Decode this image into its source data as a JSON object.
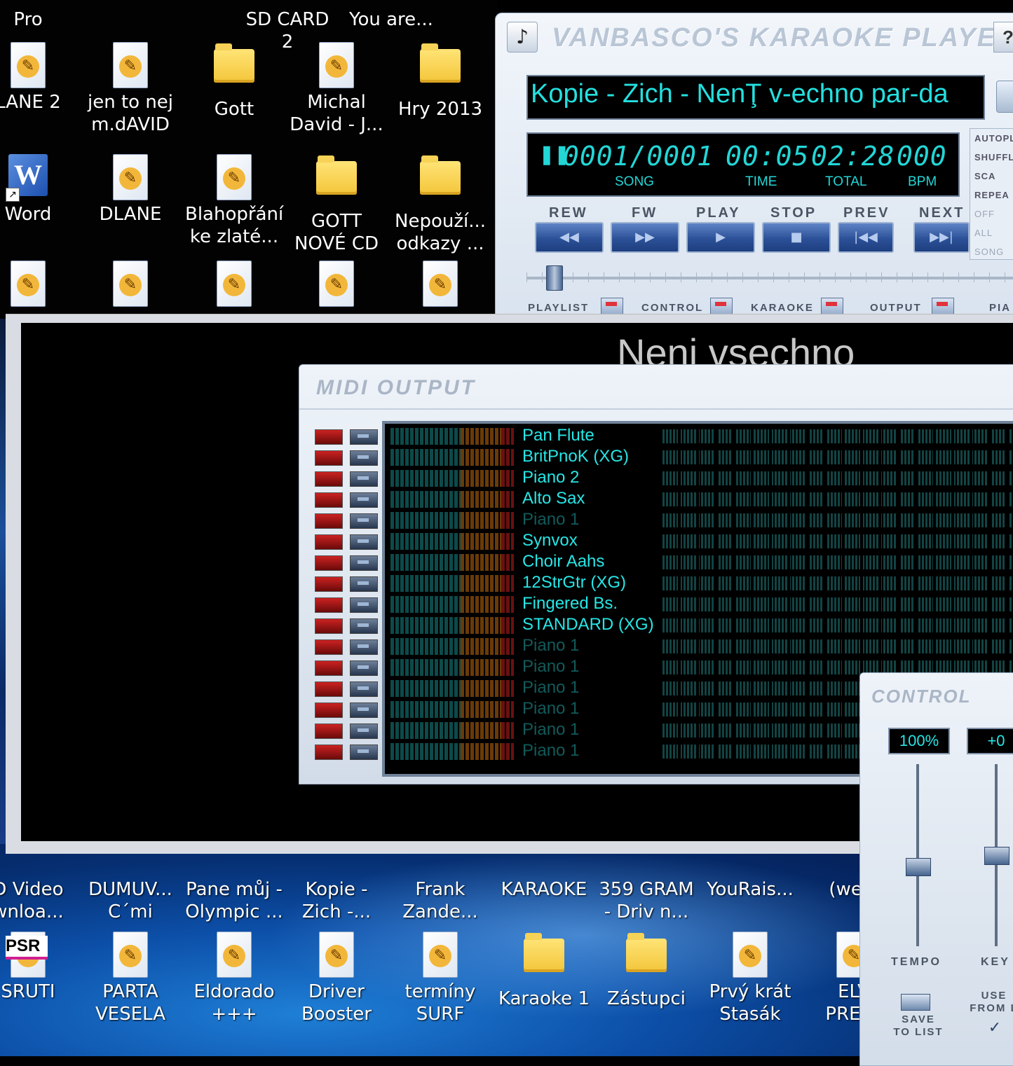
{
  "desktop": {
    "top_icons": [
      {
        "label": "Pro",
        "type": "none"
      },
      {
        "label": "SD CARD 2",
        "type": "none"
      },
      {
        "label": "You are...",
        "type": "none"
      },
      {
        "label": "LANE 2",
        "type": "doc"
      },
      {
        "label": "jen to nej\nm.dAVID",
        "type": "doc"
      },
      {
        "label": "Gott",
        "type": "folder"
      },
      {
        "label": "Michal\nDavid - J...",
        "type": "doc"
      },
      {
        "label": "Hry 2013",
        "type": "folder"
      },
      {
        "label": "Word",
        "type": "word"
      },
      {
        "label": "DLANE",
        "type": "doc"
      },
      {
        "label": "Blahopřání\nke zlaté...",
        "type": "doc"
      },
      {
        "label": "GOTT\nNOVÉ CD",
        "type": "folder"
      },
      {
        "label": "Nepouží...\nodkazy ...",
        "type": "folder"
      }
    ],
    "bottom_icons": [
      {
        "label": "D Video\nwnloa..."
      },
      {
        "label": "DUMUV...\nC´mi"
      },
      {
        "label": "Pane můj -\nOlympic ..."
      },
      {
        "label": "Kopie -\nZich -..."
      },
      {
        "label": "Frank\nZande..."
      },
      {
        "label": "KARAOKE"
      },
      {
        "label": "359 GRAM\n- Driv n..."
      },
      {
        "label": "YouRais..."
      },
      {
        "label": "(west"
      },
      {
        "label": "SRUTI"
      },
      {
        "label": "PARTA\nVESELA"
      },
      {
        "label": "Eldorado\n+++"
      },
      {
        "label": "Driver\nBooster"
      },
      {
        "label": "termíny\nSURF"
      },
      {
        "label": "Karaoke 1"
      },
      {
        "label": "Zástupci"
      },
      {
        "label": "Prvý krát\nStasák"
      },
      {
        "label": "ELV\nPRESL"
      }
    ],
    "psr_logo": "PSR"
  },
  "player": {
    "title": "VANBASCO'S KARAOKE PLAYER",
    "help": "?",
    "song_title": "Kopie - Zich - NenŢ v-echno par-da",
    "song": "0001/0001",
    "song_label": "SONG",
    "time": "00:05",
    "time_label": "TIME",
    "total": "02:28",
    "total_label": "TOTAL",
    "bpm": "000",
    "bpm_label": "BPM",
    "transport_labels": [
      "REW",
      "FW",
      "PLAY",
      "STOP",
      "PREV",
      "NEXT"
    ],
    "transport_icons": [
      "◀◀",
      "▶▶",
      "▶",
      "■",
      "|◀◀",
      "▶▶|"
    ],
    "options": [
      {
        "label": "AUTOPL",
        "dim": false
      },
      {
        "label": "SHUFFLE",
        "dim": false
      },
      {
        "label": "SCA",
        "dim": false
      },
      {
        "label": "REPEA",
        "dim": false
      },
      {
        "label": "OFF",
        "dim": true
      },
      {
        "label": "ALL",
        "dim": true
      },
      {
        "label": "SONG",
        "dim": true
      }
    ],
    "toggles": [
      "PLAYLIST",
      "CONTROL",
      "KARAOKE",
      "OUTPUT",
      "PIA"
    ]
  },
  "lyrics": {
    "current_line": "Neni  vsechno"
  },
  "midi_output": {
    "title": "MIDI OUTPUT",
    "channels": [
      {
        "instrument": "Pan Flute",
        "active": true
      },
      {
        "instrument": "BritPnoK (XG)",
        "active": true
      },
      {
        "instrument": "Piano 2",
        "active": true
      },
      {
        "instrument": "Alto Sax",
        "active": true
      },
      {
        "instrument": "Piano 1",
        "active": false
      },
      {
        "instrument": "Synvox",
        "active": true
      },
      {
        "instrument": "Choir Aahs",
        "active": true
      },
      {
        "instrument": "12StrGtr (XG)",
        "active": true
      },
      {
        "instrument": "Fingered Bs.",
        "active": true
      },
      {
        "instrument": "STANDARD (XG)",
        "active": true
      },
      {
        "instrument": "Piano 1",
        "active": false
      },
      {
        "instrument": "Piano 1",
        "active": false
      },
      {
        "instrument": "Piano 1",
        "active": false
      },
      {
        "instrument": "Piano 1",
        "active": false
      },
      {
        "instrument": "Piano 1",
        "active": false
      },
      {
        "instrument": "Piano 1",
        "active": false
      }
    ]
  },
  "control": {
    "title": "CONTROL",
    "tempo_value": "100%",
    "key_value": "+0",
    "tempo_label": "TEMPO",
    "key_label": "KEY",
    "save_label_1": "SAVE",
    "save_label_2": "TO LIST",
    "use_label_1": "USE",
    "use_label_2": "FROM L",
    "check": "✓"
  }
}
